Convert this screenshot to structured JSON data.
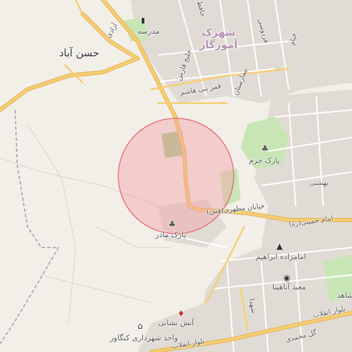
{
  "map": {
    "colors": {
      "background": "#f2efe9",
      "urban_block": "#e0dbd4",
      "park": "#c8e6b5",
      "major_road": "#f6cd72",
      "major_road_casing": "#e3b255",
      "minor_road": "#ffffff",
      "boundary": "#9b9bb3",
      "highlight_fill": "#f4a3a8",
      "highlight_stroke": "#e05b66"
    },
    "labels": {
      "hasan_abad": "حسن آباد",
      "shahrak_line1": "شهرک",
      "shahrak_line2": "آموزگار",
      "madrese": "مدرسه",
      "park_khorram": "پارک خرم",
      "park_madar": "پارک مادر",
      "emamzade": "امامزاده ابراهیم",
      "maabad": "معبد آناهیتا",
      "atash": "آتش نشانی",
      "vahed": "واحد شهرداری کنگاور",
      "shahid": "شاهد",
      "motahari": "خیابان مطهری(فش)",
      "khomeini": "امام خمینی(ره)",
      "beheshti": "بهشتی",
      "enghelab_right": "بلوار انقلاب",
      "enghelab_left": "بلوار انقلاب",
      "gol_mohammadi": "گل محمدی",
      "shahada": "شهدا",
      "hafez": "حافظ",
      "ferdowsi": "فردوسی",
      "khalij": "خلیج فارس",
      "bimarestan": "بیمارستان",
      "ghamar": "قمر بنی هاشم",
      "azadi": "آزادی",
      "khayyam": "خیام"
    },
    "icons": {
      "school": "school-icon",
      "park_khorram": "park-tree-icon",
      "park_madar": "park-tree-icon",
      "emamzade": "shrine-icon",
      "maabad": "camera-icon",
      "atash": "fire-station-icon",
      "vahed": "government-building-icon"
    },
    "highlight": {
      "shape": "circle"
    }
  }
}
